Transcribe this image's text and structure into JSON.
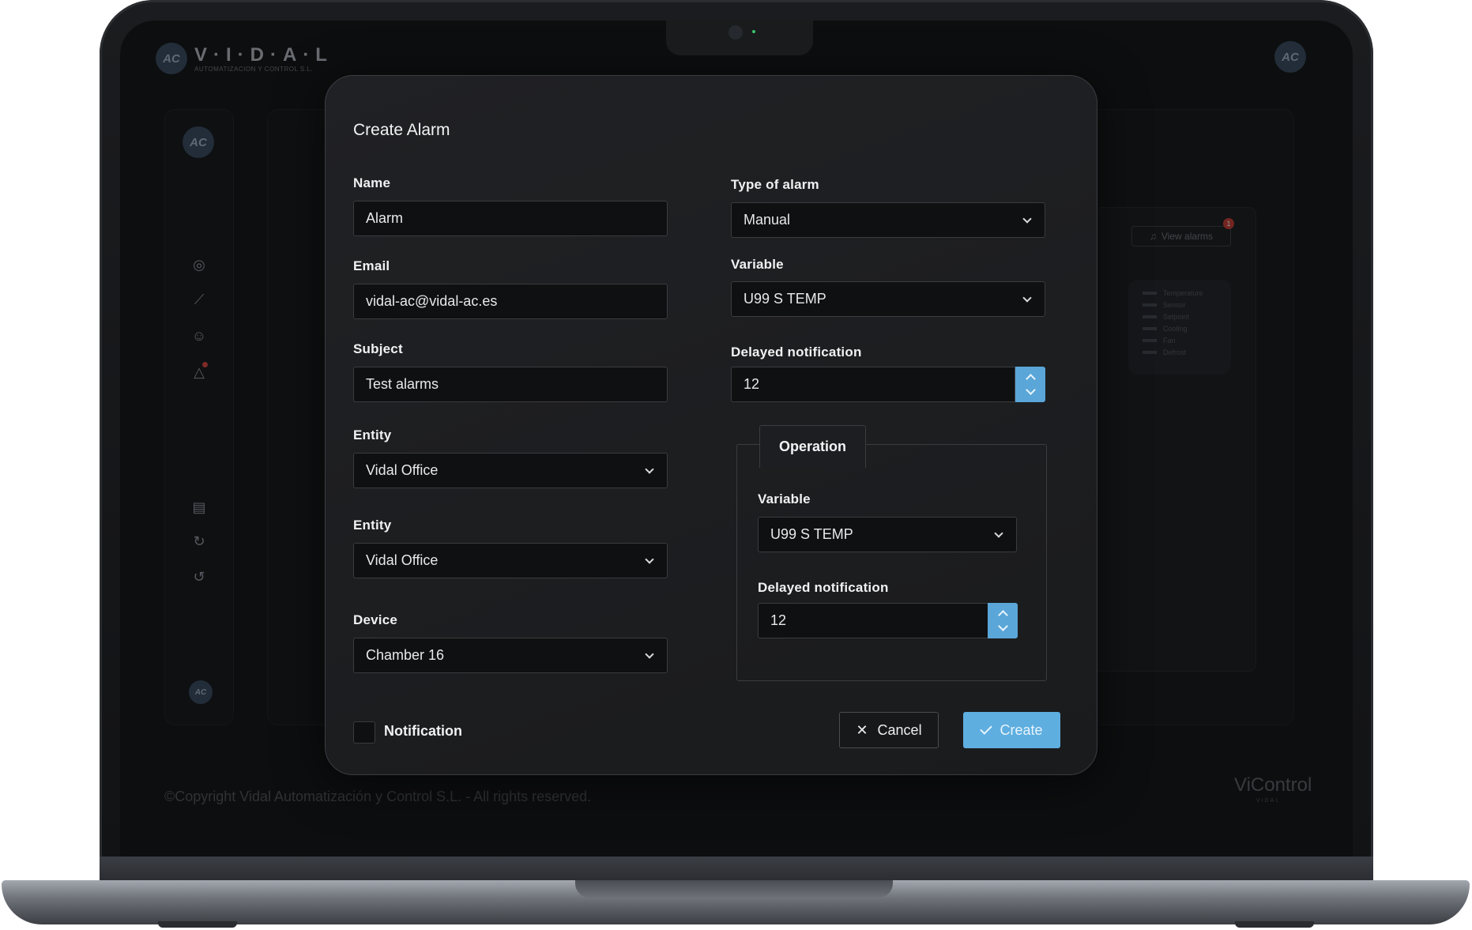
{
  "background_app": {
    "brand": "V·I·D·A·L",
    "brand_sub": "AUTOMATIZACION Y CONTROL S.L.",
    "logo_text": "AC",
    "view_alarms_label": "View alarms",
    "view_alarms_badge": "1",
    "legend": [
      "Temperature",
      "Sensor",
      "Setpoint",
      "Cooling",
      "Fan",
      "Defrost"
    ],
    "copyright": "©Copyright Vidal Automatización y Control S.L. - All rights reserved.",
    "product": "ViControl",
    "product_sub": "VIDAL"
  },
  "modal": {
    "title": "Create Alarm",
    "name_label": "Name",
    "name_value": "Alarm",
    "email_label": "Email",
    "email_value": "vidal-ac@vidal-ac.es",
    "subject_label": "Subject",
    "subject_value": "Test alarms",
    "entity1_label": "Entity",
    "entity1_value": "Vidal Office",
    "entity2_label": "Entity",
    "entity2_value": "Vidal Office",
    "device_label": "Device",
    "device_value": "Chamber 16",
    "type_label": "Type of alarm",
    "type_value": "Manual",
    "variable_label": "Variable",
    "variable_value": "U99 S TEMP",
    "delay_label": "Delayed notification",
    "delay_value": "12",
    "operation": {
      "tab_label": "Operation",
      "variable_label": "Variable",
      "variable_value": "U99 S TEMP",
      "delay_label": "Delayed notification",
      "delay_value": "12"
    },
    "notification_label": "Notification",
    "cancel_label": "Cancel",
    "create_label": "Create"
  },
  "colors": {
    "accent": "#5eaee0",
    "modal_bg": "#1e1f22",
    "field_bg": "#0f1011"
  }
}
